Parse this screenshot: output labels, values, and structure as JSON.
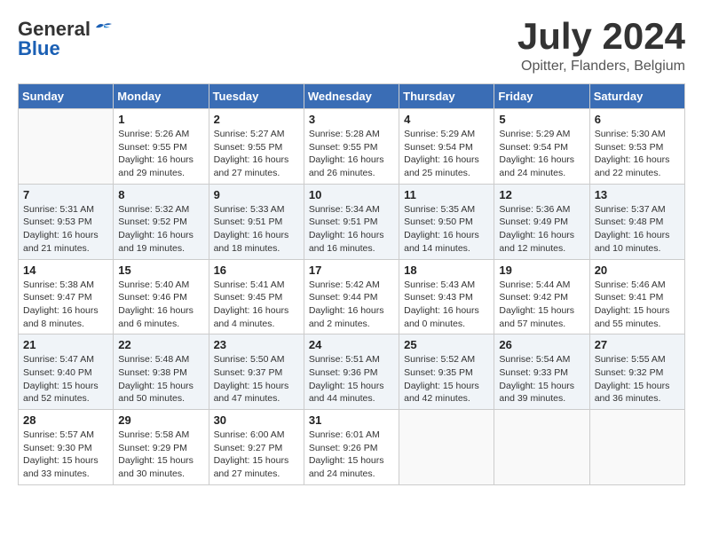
{
  "header": {
    "logo_line1": "General",
    "logo_line2": "Blue",
    "month": "July 2024",
    "location": "Opitter, Flanders, Belgium"
  },
  "weekdays": [
    "Sunday",
    "Monday",
    "Tuesday",
    "Wednesday",
    "Thursday",
    "Friday",
    "Saturday"
  ],
  "weeks": [
    [
      {
        "day": "",
        "info": ""
      },
      {
        "day": "1",
        "info": "Sunrise: 5:26 AM\nSunset: 9:55 PM\nDaylight: 16 hours\nand 29 minutes."
      },
      {
        "day": "2",
        "info": "Sunrise: 5:27 AM\nSunset: 9:55 PM\nDaylight: 16 hours\nand 27 minutes."
      },
      {
        "day": "3",
        "info": "Sunrise: 5:28 AM\nSunset: 9:55 PM\nDaylight: 16 hours\nand 26 minutes."
      },
      {
        "day": "4",
        "info": "Sunrise: 5:29 AM\nSunset: 9:54 PM\nDaylight: 16 hours\nand 25 minutes."
      },
      {
        "day": "5",
        "info": "Sunrise: 5:29 AM\nSunset: 9:54 PM\nDaylight: 16 hours\nand 24 minutes."
      },
      {
        "day": "6",
        "info": "Sunrise: 5:30 AM\nSunset: 9:53 PM\nDaylight: 16 hours\nand 22 minutes."
      }
    ],
    [
      {
        "day": "7",
        "info": "Sunrise: 5:31 AM\nSunset: 9:53 PM\nDaylight: 16 hours\nand 21 minutes."
      },
      {
        "day": "8",
        "info": "Sunrise: 5:32 AM\nSunset: 9:52 PM\nDaylight: 16 hours\nand 19 minutes."
      },
      {
        "day": "9",
        "info": "Sunrise: 5:33 AM\nSunset: 9:51 PM\nDaylight: 16 hours\nand 18 minutes."
      },
      {
        "day": "10",
        "info": "Sunrise: 5:34 AM\nSunset: 9:51 PM\nDaylight: 16 hours\nand 16 minutes."
      },
      {
        "day": "11",
        "info": "Sunrise: 5:35 AM\nSunset: 9:50 PM\nDaylight: 16 hours\nand 14 minutes."
      },
      {
        "day": "12",
        "info": "Sunrise: 5:36 AM\nSunset: 9:49 PM\nDaylight: 16 hours\nand 12 minutes."
      },
      {
        "day": "13",
        "info": "Sunrise: 5:37 AM\nSunset: 9:48 PM\nDaylight: 16 hours\nand 10 minutes."
      }
    ],
    [
      {
        "day": "14",
        "info": "Sunrise: 5:38 AM\nSunset: 9:47 PM\nDaylight: 16 hours\nand 8 minutes."
      },
      {
        "day": "15",
        "info": "Sunrise: 5:40 AM\nSunset: 9:46 PM\nDaylight: 16 hours\nand 6 minutes."
      },
      {
        "day": "16",
        "info": "Sunrise: 5:41 AM\nSunset: 9:45 PM\nDaylight: 16 hours\nand 4 minutes."
      },
      {
        "day": "17",
        "info": "Sunrise: 5:42 AM\nSunset: 9:44 PM\nDaylight: 16 hours\nand 2 minutes."
      },
      {
        "day": "18",
        "info": "Sunrise: 5:43 AM\nSunset: 9:43 PM\nDaylight: 16 hours\nand 0 minutes."
      },
      {
        "day": "19",
        "info": "Sunrise: 5:44 AM\nSunset: 9:42 PM\nDaylight: 15 hours\nand 57 minutes."
      },
      {
        "day": "20",
        "info": "Sunrise: 5:46 AM\nSunset: 9:41 PM\nDaylight: 15 hours\nand 55 minutes."
      }
    ],
    [
      {
        "day": "21",
        "info": "Sunrise: 5:47 AM\nSunset: 9:40 PM\nDaylight: 15 hours\nand 52 minutes."
      },
      {
        "day": "22",
        "info": "Sunrise: 5:48 AM\nSunset: 9:38 PM\nDaylight: 15 hours\nand 50 minutes."
      },
      {
        "day": "23",
        "info": "Sunrise: 5:50 AM\nSunset: 9:37 PM\nDaylight: 15 hours\nand 47 minutes."
      },
      {
        "day": "24",
        "info": "Sunrise: 5:51 AM\nSunset: 9:36 PM\nDaylight: 15 hours\nand 44 minutes."
      },
      {
        "day": "25",
        "info": "Sunrise: 5:52 AM\nSunset: 9:35 PM\nDaylight: 15 hours\nand 42 minutes."
      },
      {
        "day": "26",
        "info": "Sunrise: 5:54 AM\nSunset: 9:33 PM\nDaylight: 15 hours\nand 39 minutes."
      },
      {
        "day": "27",
        "info": "Sunrise: 5:55 AM\nSunset: 9:32 PM\nDaylight: 15 hours\nand 36 minutes."
      }
    ],
    [
      {
        "day": "28",
        "info": "Sunrise: 5:57 AM\nSunset: 9:30 PM\nDaylight: 15 hours\nand 33 minutes."
      },
      {
        "day": "29",
        "info": "Sunrise: 5:58 AM\nSunset: 9:29 PM\nDaylight: 15 hours\nand 30 minutes."
      },
      {
        "day": "30",
        "info": "Sunrise: 6:00 AM\nSunset: 9:27 PM\nDaylight: 15 hours\nand 27 minutes."
      },
      {
        "day": "31",
        "info": "Sunrise: 6:01 AM\nSunset: 9:26 PM\nDaylight: 15 hours\nand 24 minutes."
      },
      {
        "day": "",
        "info": ""
      },
      {
        "day": "",
        "info": ""
      },
      {
        "day": "",
        "info": ""
      }
    ]
  ]
}
